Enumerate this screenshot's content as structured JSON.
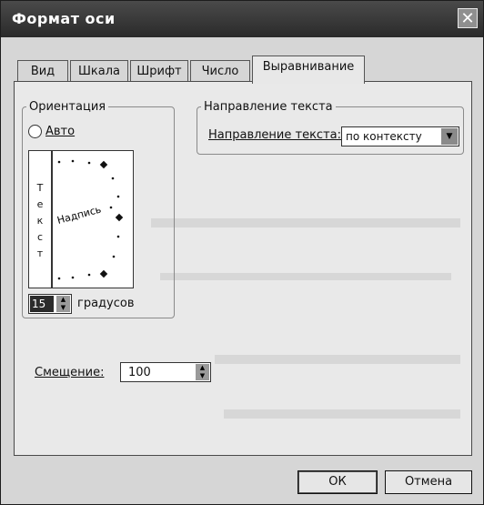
{
  "window": {
    "title": "Формат оси",
    "close_glyph": "✕"
  },
  "tabs": [
    {
      "label": "Вид"
    },
    {
      "label": "Шкала"
    },
    {
      "label": "Шрифт"
    },
    {
      "label": "Число"
    },
    {
      "label": "Выравнивание",
      "active": true
    }
  ],
  "orientation": {
    "legend": "Ориентация",
    "auto_label": "Авто",
    "vertical_text": [
      "Т",
      "е",
      "к",
      "с",
      "т"
    ],
    "dial_label": "Надпись",
    "degrees_value": "15",
    "degrees_label": "градусов"
  },
  "text_direction": {
    "legend": "Направление текста",
    "label": "Направление текста:",
    "value": "по контексту"
  },
  "offset": {
    "label": "Смещение:",
    "value": "100"
  },
  "buttons": {
    "ok": "ОК",
    "cancel": "Отмена"
  }
}
